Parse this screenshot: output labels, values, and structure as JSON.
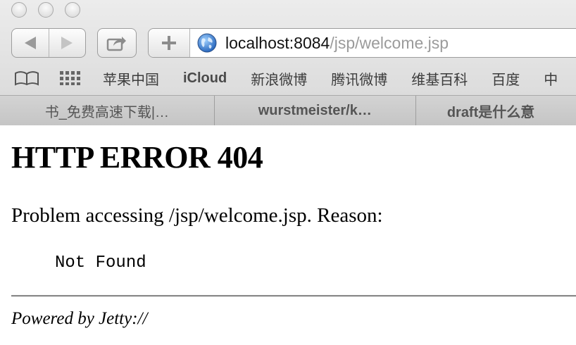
{
  "browser": {
    "address": {
      "host": "localhost:8084",
      "path": "/jsp/welcome.jsp"
    },
    "bookmarks": [
      {
        "label": "苹果中国"
      },
      {
        "label": "iCloud"
      },
      {
        "label": "新浪微博"
      },
      {
        "label": "腾讯微博"
      },
      {
        "label": "维基百科"
      },
      {
        "label": "百度"
      },
      {
        "label": "中"
      }
    ],
    "tabs": [
      {
        "label": "书_免费高速下载|…"
      },
      {
        "label": "wurstmeister/k…"
      },
      {
        "label": "draft是什么意"
      }
    ],
    "icons": [
      "back-icon",
      "forward-icon",
      "share-icon",
      "plus-icon",
      "globe-icon",
      "reading-list-icon",
      "top-sites-icon"
    ]
  },
  "page": {
    "heading": "HTTP ERROR 404",
    "problem": "Problem accessing /jsp/welcome.jsp. Reason:",
    "reason": "Not Found",
    "footer": "Powered by Jetty://"
  }
}
